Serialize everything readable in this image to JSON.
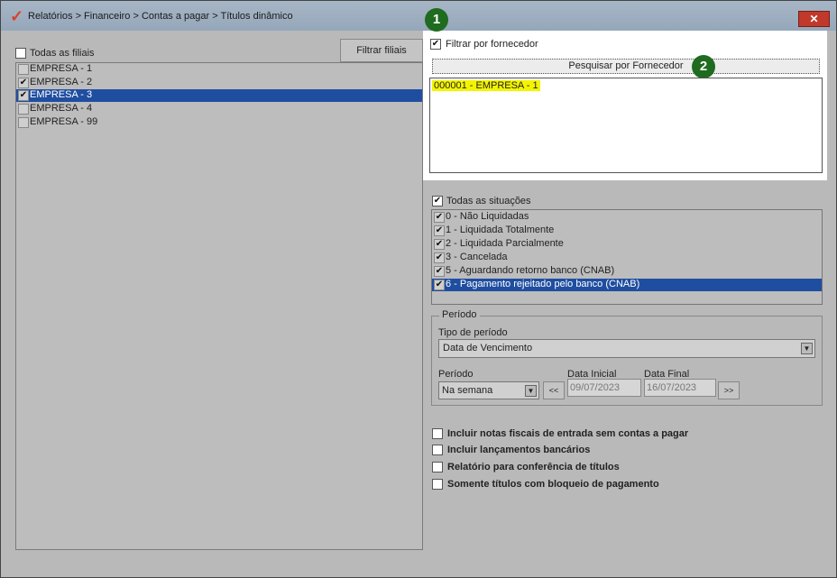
{
  "window": {
    "title": "Relatórios > Financeiro > Contas a pagar > Títulos dinâmico",
    "close_label": "✕"
  },
  "markers": [
    "1",
    "2"
  ],
  "filiais": {
    "all_label": "Todas as filiais",
    "filter_button": "Filtrar filiais",
    "items": [
      {
        "label": "EMPRESA - 1",
        "checked": ""
      },
      {
        "label": "EMPRESA - 2",
        "checked": "✔"
      },
      {
        "label": "EMPRESA - 3",
        "checked": "✔"
      },
      {
        "label": "EMPRESA - 4",
        "checked": ""
      },
      {
        "label": "EMPRESA - 99",
        "checked": ""
      }
    ]
  },
  "fornecedor": {
    "filter_label": "Filtrar por fornecedor",
    "filter_checked": "✔",
    "search_button": "Pesquisar por Fornecedor",
    "selected_item": "000001 - EMPRESA - 1"
  },
  "situacoes": {
    "all_label": "Todas as situações",
    "all_checked": "✔",
    "items": [
      {
        "label": "0 - Não Liquidadas",
        "checked": "✔"
      },
      {
        "label": "1 - Liquidada Totalmente",
        "checked": "✔"
      },
      {
        "label": "2 - Liquidada Parcialmente",
        "checked": "✔"
      },
      {
        "label": "3 - Cancelada",
        "checked": "✔"
      },
      {
        "label": "5 - Aguardando retorno banco (CNAB)",
        "checked": "✔"
      },
      {
        "label": "6 - Pagamento rejeitado pelo banco (CNAB)",
        "checked": "✔"
      }
    ]
  },
  "periodo": {
    "group_title": "Período",
    "tipo_label": "Tipo de período",
    "tipo_value": "Data de Vencimento",
    "periodo_label": "Período",
    "periodo_value": "Na semana",
    "prev_button": "<<",
    "next_button": ">>",
    "data_inicial_label": "Data Inicial",
    "data_inicial_value": "09/07/2023",
    "data_final_label": "Data Final",
    "data_final_value": "16/07/2023"
  },
  "options": [
    "Incluir notas fiscais de entrada sem contas a pagar",
    "Incluir lançamentos bancários",
    "Relatório para conferência de títulos",
    "Somente títulos com bloqueio de pagamento"
  ]
}
